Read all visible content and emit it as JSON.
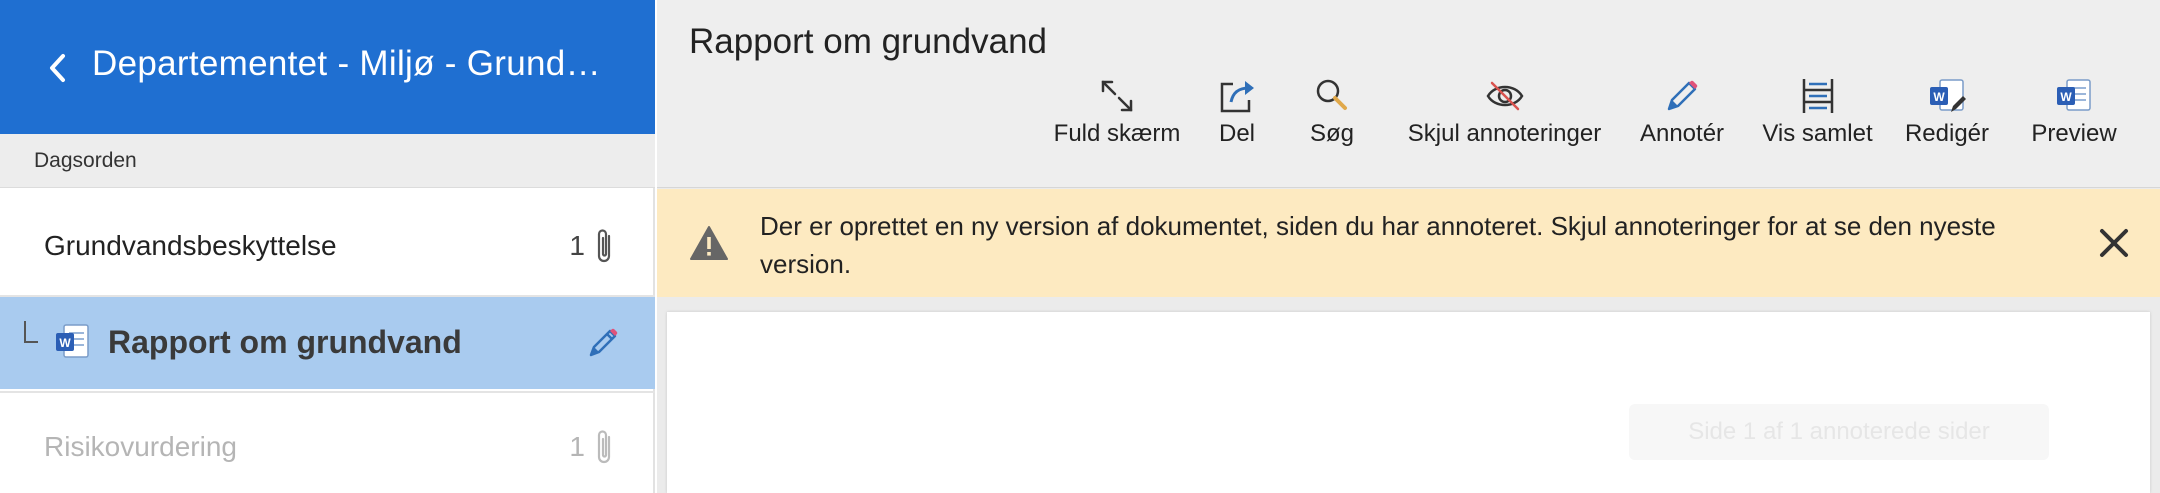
{
  "sidebar": {
    "title": "Departementet - Miljø - Grundvandsudvalget",
    "section_label": "Dagsorden",
    "items": [
      {
        "label": "Grundvandsbeskyttelse",
        "count": "1"
      },
      {
        "label": "Risikovurdering",
        "count": "1"
      }
    ],
    "active_document": {
      "label": "Rapport om grundvand"
    }
  },
  "main": {
    "title": "Rapport om grundvand",
    "toolbar": [
      {
        "label": "Fuld skærm",
        "icon": "fullscreen-icon"
      },
      {
        "label": "Del",
        "icon": "share-icon"
      },
      {
        "label": "Søg",
        "icon": "search-icon"
      },
      {
        "label": "Skjul annoteringer",
        "icon": "eye-off-icon"
      },
      {
        "label": "Annotér",
        "icon": "pencil-icon"
      },
      {
        "label": "Vis samlet",
        "icon": "combined-view-icon"
      },
      {
        "label": "Redigér",
        "icon": "word-edit-icon"
      },
      {
        "label": "Preview",
        "icon": "word-preview-icon"
      }
    ],
    "warning": {
      "text": "Der er oprettet en ny version af dokumentet, siden du har annoteret. Skjul annoteringer for at se den nyeste version."
    },
    "viewer": {
      "page_indicator": "Side 1 af 1 annoterede sider"
    }
  },
  "colors": {
    "header_blue": "#1f6fd1",
    "selected_item": "#a9cbef",
    "warning_bg": "#fdeac1",
    "icon_blue": "#2f6fb8"
  }
}
